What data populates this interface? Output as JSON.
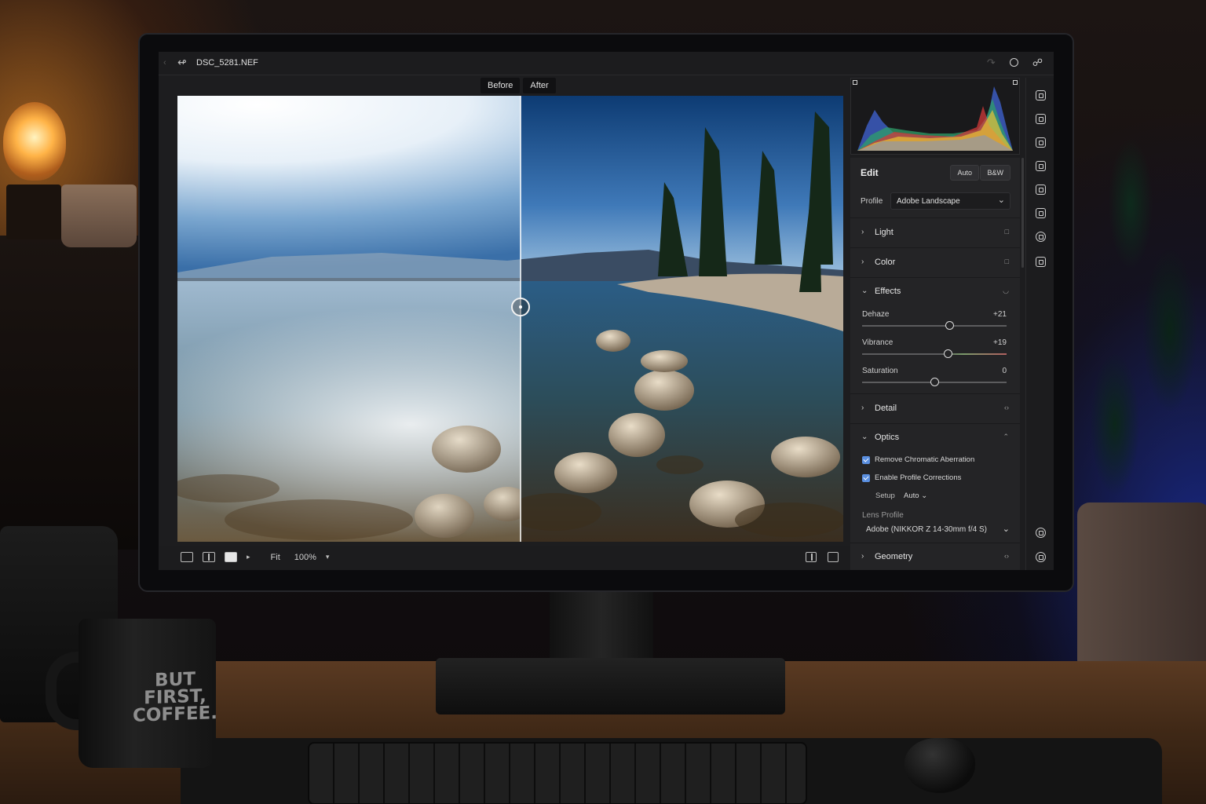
{
  "app": {
    "file_name": "DSC_5281.NEF",
    "compare": {
      "before_label": "Before",
      "after_label": "After"
    }
  },
  "toolbar": {
    "fit_label": "Fit",
    "zoom_label": "100%"
  },
  "edit_panel": {
    "title": "Edit",
    "auto_label": "Auto",
    "bw_label": "B&W",
    "profile_label": "Profile",
    "profile_value": "Adobe Landscape",
    "sections": {
      "light": "Light",
      "color": "Color",
      "effects": "Effects",
      "detail": "Detail",
      "optics": "Optics",
      "geometry": "Geometry"
    },
    "effects": {
      "dehaze": {
        "label": "Dehaze",
        "value": "+21",
        "level": 21
      },
      "vibrance": {
        "label": "Vibrance",
        "value": "+19",
        "level": 19
      },
      "saturation": {
        "label": "Saturation",
        "value": "0",
        "level": 0
      }
    },
    "optics": {
      "remove_ca_label": "Remove Chromatic Aberration",
      "remove_ca_checked": true,
      "profile_corrections_label": "Enable Profile Corrections",
      "profile_corrections_checked": true,
      "setup_label": "Setup",
      "setup_value": "Auto",
      "lens_profile_label": "Lens Profile",
      "lens_profile_value": "Adobe (NIKKOR Z 14-30mm f/4 S)"
    }
  },
  "mug": {
    "text": "BUT FIRST, COFFEE."
  },
  "colors": {
    "accent": "#5a8fe0",
    "panel": "#242426",
    "background": "#1d1d1f"
  }
}
